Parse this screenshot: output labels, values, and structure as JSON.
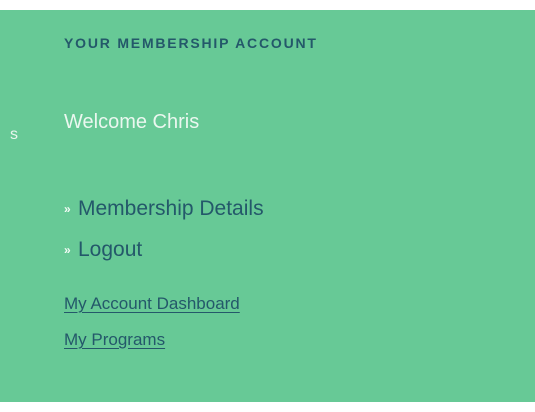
{
  "sidebar": {
    "clipped_left_text": "s",
    "heading": "YOUR MEMBERSHIP ACCOUNT",
    "welcome": "Welcome Chris",
    "menu": [
      {
        "bullet": "»",
        "label": "Membership Details"
      },
      {
        "bullet": "»",
        "label": "Logout"
      }
    ],
    "links": [
      {
        "label": "My Account Dashboard"
      },
      {
        "label": "My Programs"
      }
    ]
  },
  "colors": {
    "panel_background": "#67c996",
    "link_text": "#24586a",
    "light_text": "#eaf7ef"
  }
}
